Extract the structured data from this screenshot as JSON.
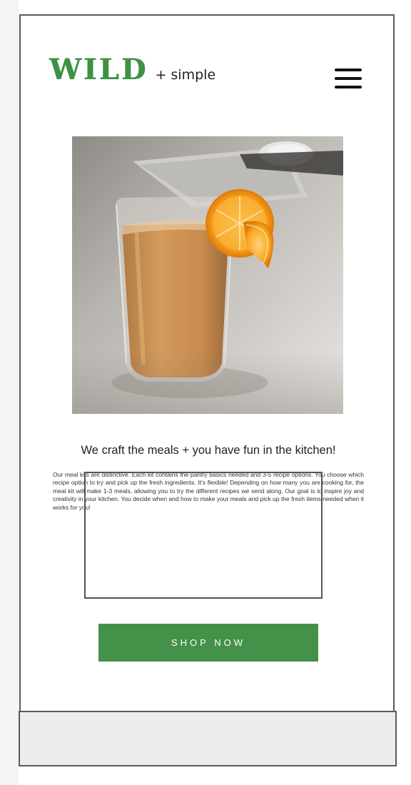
{
  "header": {
    "logo_wild": "WILD",
    "logo_simple": "+ simple",
    "menu_icon": "hamburger-menu-icon"
  },
  "hero": {
    "image_subject": "glass of orange smoothie with orange slice"
  },
  "main": {
    "headline": "We craft the meals + you have fun in the kitchen!",
    "description": "Our meal kits are distinctive. Each kit contains the pantry basics needed and 3-5 recipe options. You choose which recipe option to try and pick up the fresh ingredients. It's flexible! Depending on how many you are cooking for, the meal kit will make 1-3 meals, allowing you to try the different recipes we send along. Our goal is to inspire joy and creativity in your kitchen. You decide when and how to make your meals and pick up the fresh items needed when it works for you!",
    "cta_label": "SHOP NOW"
  },
  "colors": {
    "brand_green": "#44914a",
    "text_dark": "#222222",
    "footer_bg": "#ececec"
  }
}
